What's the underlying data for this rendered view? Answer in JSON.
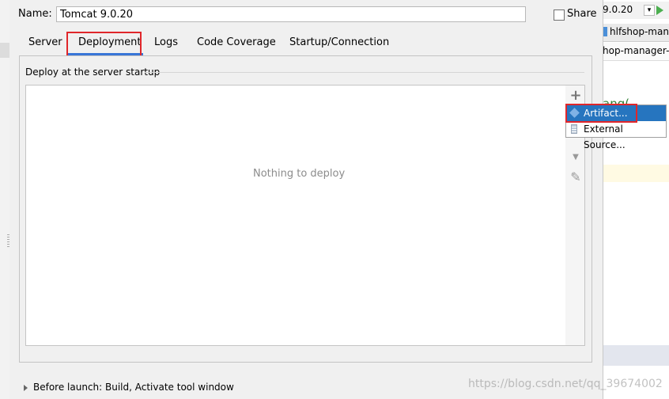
{
  "dialog": {
    "name_label": "Name:",
    "name_value": "Tomcat 9.0.20",
    "share_label": "Share",
    "share_checked": false,
    "tabs": [
      {
        "label": "Server",
        "active": false
      },
      {
        "label": "Deployment",
        "active": true
      },
      {
        "label": "Logs",
        "active": false
      },
      {
        "label": "Code Coverage",
        "active": false
      },
      {
        "label": "Startup/Connection",
        "active": false
      }
    ],
    "section_label": "Deploy at the server startup",
    "empty_text": "Nothing to deploy",
    "toolbar_icons": [
      "plus-icon",
      "arrow-down-icon",
      "pencil-icon"
    ],
    "popup_items": [
      {
        "label": "Artifact...",
        "icon": "artifact-icon",
        "selected": true
      },
      {
        "label": "External Source...",
        "icon": "external-source-icon",
        "selected": false
      }
    ],
    "before_launch": "Before launch: Build, Activate tool window"
  },
  "ide_background": {
    "run_config": "9.0.20",
    "tab_fragment": "hlfshop-mana",
    "breadcrumb_fragment": "hop-manager-",
    "code_fragment": "ang("
  },
  "watermark": "https://blog.csdn.net/qq_39674002",
  "colors": {
    "accent": "#3875d7",
    "highlight_box": "#e0262a",
    "popup_selected": "#2675bf"
  }
}
